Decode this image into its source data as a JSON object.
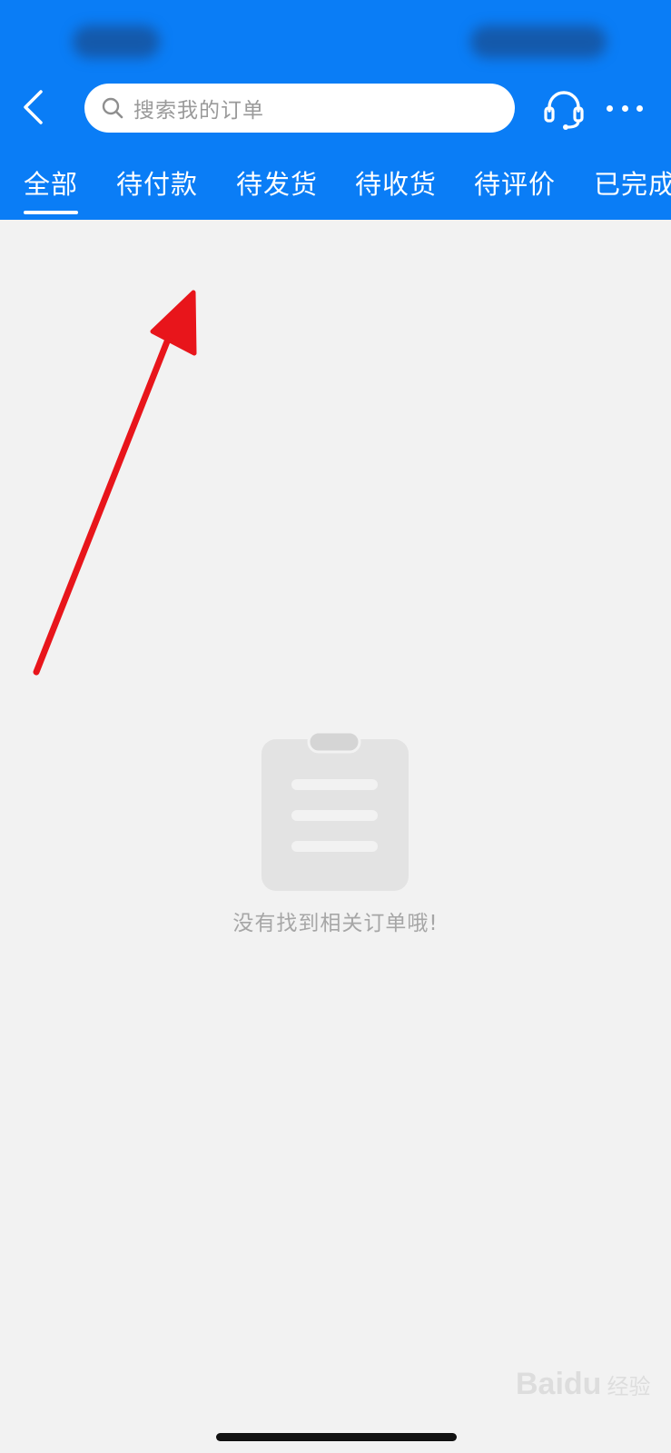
{
  "header": {
    "bg_color": "#0a7df6",
    "back_icon": "chevron-left-icon",
    "search_placeholder": "搜索我的订单",
    "search_icon": "search-icon",
    "support_icon": "headset-icon",
    "more_icon": "more-dots-icon"
  },
  "tabs": [
    {
      "label": "全部",
      "active": true
    },
    {
      "label": "待付款",
      "active": false
    },
    {
      "label": "待发货",
      "active": false
    },
    {
      "label": "待收货",
      "active": false
    },
    {
      "label": "待评价",
      "active": false
    },
    {
      "label": "已完成",
      "active": false
    }
  ],
  "empty_state": {
    "icon": "clipboard-icon",
    "message": "没有找到相关订单哦!"
  },
  "annotation": {
    "arrow_color": "#e8151b"
  },
  "watermark": {
    "latin": "Baidu",
    "chinese": "经验"
  }
}
